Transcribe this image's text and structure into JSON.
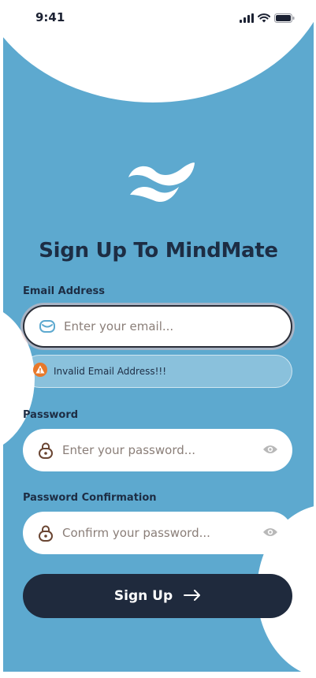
{
  "status_bar": {
    "time": "9:41"
  },
  "page": {
    "title": "Sign Up To MindMate"
  },
  "email": {
    "label": "Email Address",
    "placeholder": "Enter your email...",
    "error": "Invalid Email Address!!!"
  },
  "password": {
    "label": "Password",
    "placeholder": "Enter your password..."
  },
  "password_confirmation": {
    "label": "Password Confirmation",
    "placeholder": "Confirm your password..."
  },
  "signup_button": {
    "label": "Sign Up"
  },
  "colors": {
    "background": "#5da9cf",
    "accent_dark": "#1f2a3d",
    "text_dark": "#1d2d44",
    "warning": "#e8782a",
    "icon_brown": "#6a4532",
    "email_icon": "#5da9cf"
  },
  "icons": [
    "signal-icon",
    "wifi-icon",
    "battery-icon",
    "mindmate-logo",
    "mail-icon",
    "warning-icon",
    "lock-icon",
    "eye-icon",
    "arrow-right-icon"
  ]
}
